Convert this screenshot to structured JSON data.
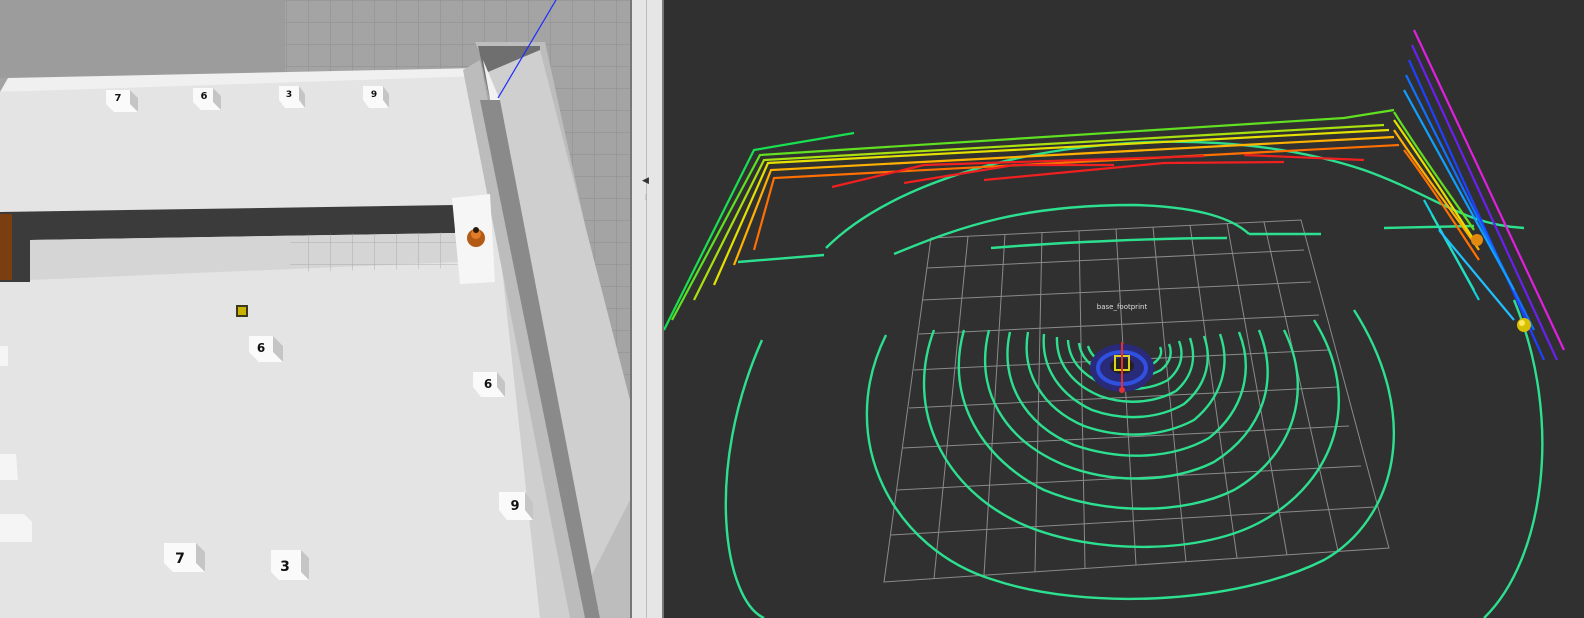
{
  "gazebo": {
    "cube_labels": {
      "top_row": [
        "7",
        "6",
        "3",
        "9"
      ],
      "middle_left": "6",
      "middle_right": "6",
      "lower_right": "9",
      "bottom_left": "7",
      "bottom_right": "3"
    }
  },
  "splitter": {
    "collapse_glyph": "◀",
    "grip_glyph": "⋮"
  },
  "rviz": {
    "tf_label": "base_footprint"
  },
  "colors": {
    "gazebo_ground": "#a6a6a6",
    "wall": "#e3e3e3",
    "rviz_background": "#303030",
    "laser_green": "#2de08f",
    "robot_blue": "#2233bb"
  }
}
